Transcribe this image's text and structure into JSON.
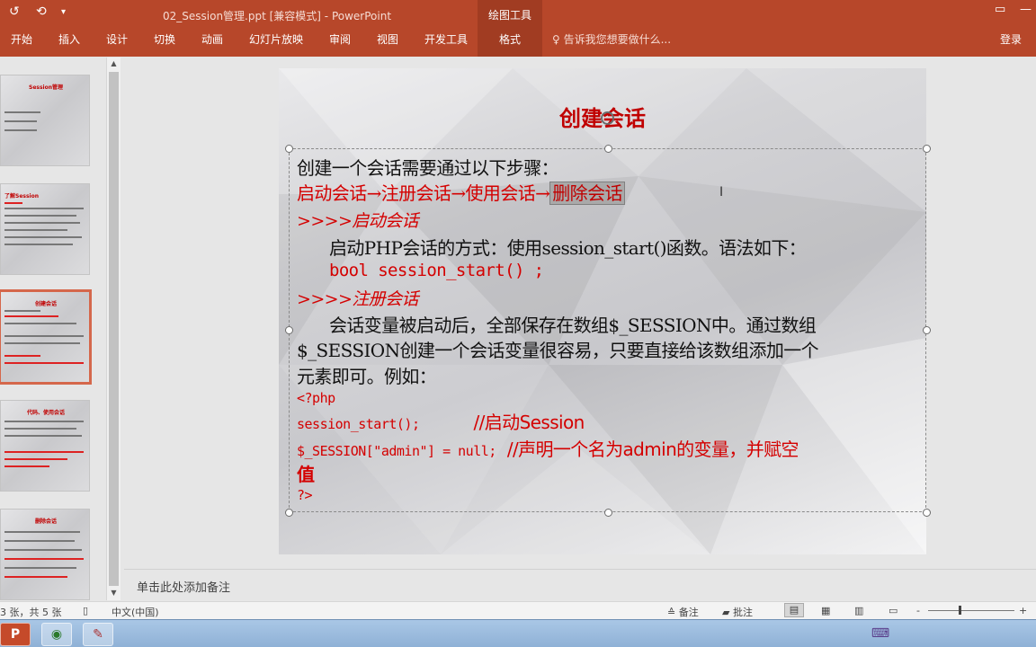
{
  "titlebar": {
    "quick_access": [
      "↺",
      "⟲",
      "▾"
    ],
    "doc_title": "02_Session管理.ppt [兼容模式] - PowerPoint",
    "context_group": "绘图工具",
    "window_controls": [
      "▭",
      "—",
      "□",
      "✕"
    ]
  },
  "ribbon": {
    "tabs": [
      "开始",
      "插入",
      "设计",
      "切换",
      "动画",
      "幻灯片放映",
      "审阅",
      "视图",
      "开发工具"
    ],
    "active_tab": "格式",
    "tell_me": "告诉我您想要做什么...",
    "sign_in": "登录"
  },
  "thumbnails": [
    {
      "title": "Session管理"
    },
    {
      "title": "了解Session"
    },
    {
      "title": "创建会话"
    },
    {
      "title": "代码、使用会话"
    },
    {
      "title": "删除会话"
    }
  ],
  "slide": {
    "title": "创建会话",
    "line1": "创建一个会话需要通过以下步骤：",
    "line2_main": "启动会话→注册会话→使用会话→",
    "line2_selected": "删除会话",
    "line3": ">>>>启动会话",
    "line4": "启动PHP会话的方式：使用session_start()函数。语法如下：",
    "line5": "bool session_start() ;",
    "line6": ">>>>注册会话",
    "line7": "会话变量被启动后，全部保存在数组$_SESSION中。通过数组",
    "line8": "$_SESSION创建一个会话变量很容易，只要直接给该数组添加一个",
    "line9": "元素即可。例如：",
    "code1": "<?php",
    "code2_code": "session_start();",
    "code2_comment": "//启动Session",
    "code3_code": "$_SESSION[\"admin\"] = null;",
    "code3_comment": "//声明一个名为admin的变量，并赋空",
    "code3_cont": "值",
    "code4": "?>"
  },
  "notes_placeholder": "单击此处添加备注",
  "status": {
    "slide_count": "3 张，共 5 张",
    "language": "中文(中国)",
    "notes_btn": "备注",
    "comments_btn": "批注",
    "zoom_minus": "-",
    "zoom_plus": "+"
  },
  "taskbar": {
    "apps": [
      "P",
      "◉",
      "✎"
    ]
  }
}
